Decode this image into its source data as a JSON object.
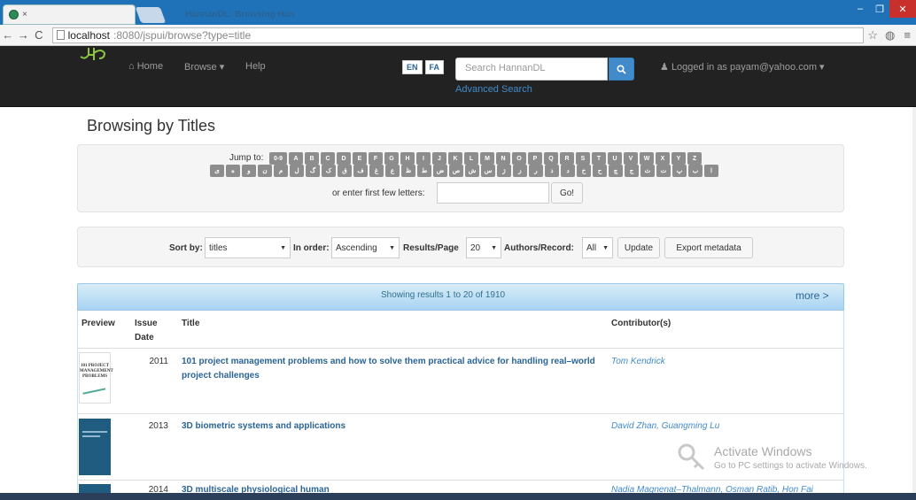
{
  "browser": {
    "tab_title": "HannanDL: Browsing Han",
    "tab_close": "×",
    "url_host": "localhost",
    "url_path": ":8080/jspui/browse?type=title"
  },
  "nav": {
    "home": "Home",
    "browse": "Browse ▾",
    "help": "Help",
    "lang_en": "EN",
    "lang_fa": "FA",
    "search_placeholder": "Search HannanDL",
    "advanced_search": "Advanced Search",
    "logged_in": "Logged in as payam@yahoo.com ▾"
  },
  "page": {
    "heading": "Browsing by Titles",
    "jump_to": "Jump to:",
    "latin_letters": [
      "0-9",
      "A",
      "B",
      "C",
      "D",
      "E",
      "F",
      "G",
      "H",
      "I",
      "J",
      "K",
      "L",
      "M",
      "N",
      "O",
      "P",
      "Q",
      "R",
      "S",
      "T",
      "U",
      "V",
      "W",
      "X",
      "Y",
      "Z"
    ],
    "persian_letters": [
      "ی",
      "ه",
      "و",
      "ن",
      "م",
      "ل",
      "گ",
      "ک",
      "ق",
      "ف",
      "غ",
      "ع",
      "ظ",
      "ط",
      "ض",
      "ص",
      "ش",
      "س",
      "ژ",
      "ز",
      "ر",
      "ذ",
      "د",
      "خ",
      "ح",
      "چ",
      "ج",
      "ث",
      "ت",
      "پ",
      "ب",
      "ا"
    ],
    "first_letters_label": "or enter first few letters:",
    "go": "Go!"
  },
  "sort": {
    "sort_by_label": "Sort by:",
    "sort_by_value": "titles",
    "in_order_label": "In order:",
    "in_order_value": "Ascending",
    "results_label": "Results/Page",
    "results_value": "20",
    "authors_label": "Authors/Record:",
    "authors_value": "All",
    "update": "Update",
    "export": "Export metadata"
  },
  "results": {
    "showing": "Showing results 1 to 20 of 1910",
    "more": "more >",
    "columns": {
      "preview": "Preview",
      "issue_date": "Issue Date",
      "title": "Title",
      "contributors": "Contributor(s)"
    },
    "rows": [
      {
        "year": "2011",
        "title": "101 project management problems and how to solve them practical advice for handling real–world project challenges",
        "contributors": "Tom Kendrick"
      },
      {
        "year": "2013",
        "title": "3D biometric systems and applications",
        "contributors": "David Zhan, Guangming Lu"
      },
      {
        "year": "2014",
        "title": "3D multiscale physiological human",
        "contributors": "Nadia Magnenat–Thalmann, Osman Ratib, Hon Fai"
      }
    ]
  },
  "thumb1": {
    "line1": "101 PROJECT",
    "line2": "MANAGEMENT",
    "line3": "PROBLEMS"
  },
  "watermark": {
    "big": "Activate Windows",
    "small": "Go to PC settings to activate Windows."
  }
}
